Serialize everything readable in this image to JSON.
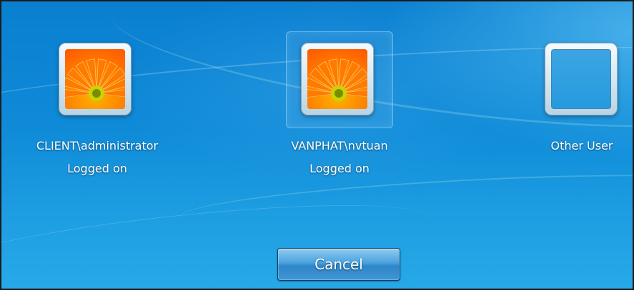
{
  "users": [
    {
      "name": "CLIENT\\administrator",
      "status": "Logged on",
      "picture": "orange-gerbera-flower"
    },
    {
      "name": "VANPHAT\\nvtuan",
      "status": "Logged on",
      "picture": "orange-gerbera-flower",
      "selected": true
    },
    {
      "name": "Other User",
      "status": "",
      "picture": "empty-frame"
    }
  ],
  "actions": {
    "cancel_label": "Cancel"
  },
  "colors": {
    "background": "#0f8bd8",
    "text": "#ffffff",
    "button": "#3f96d6"
  }
}
